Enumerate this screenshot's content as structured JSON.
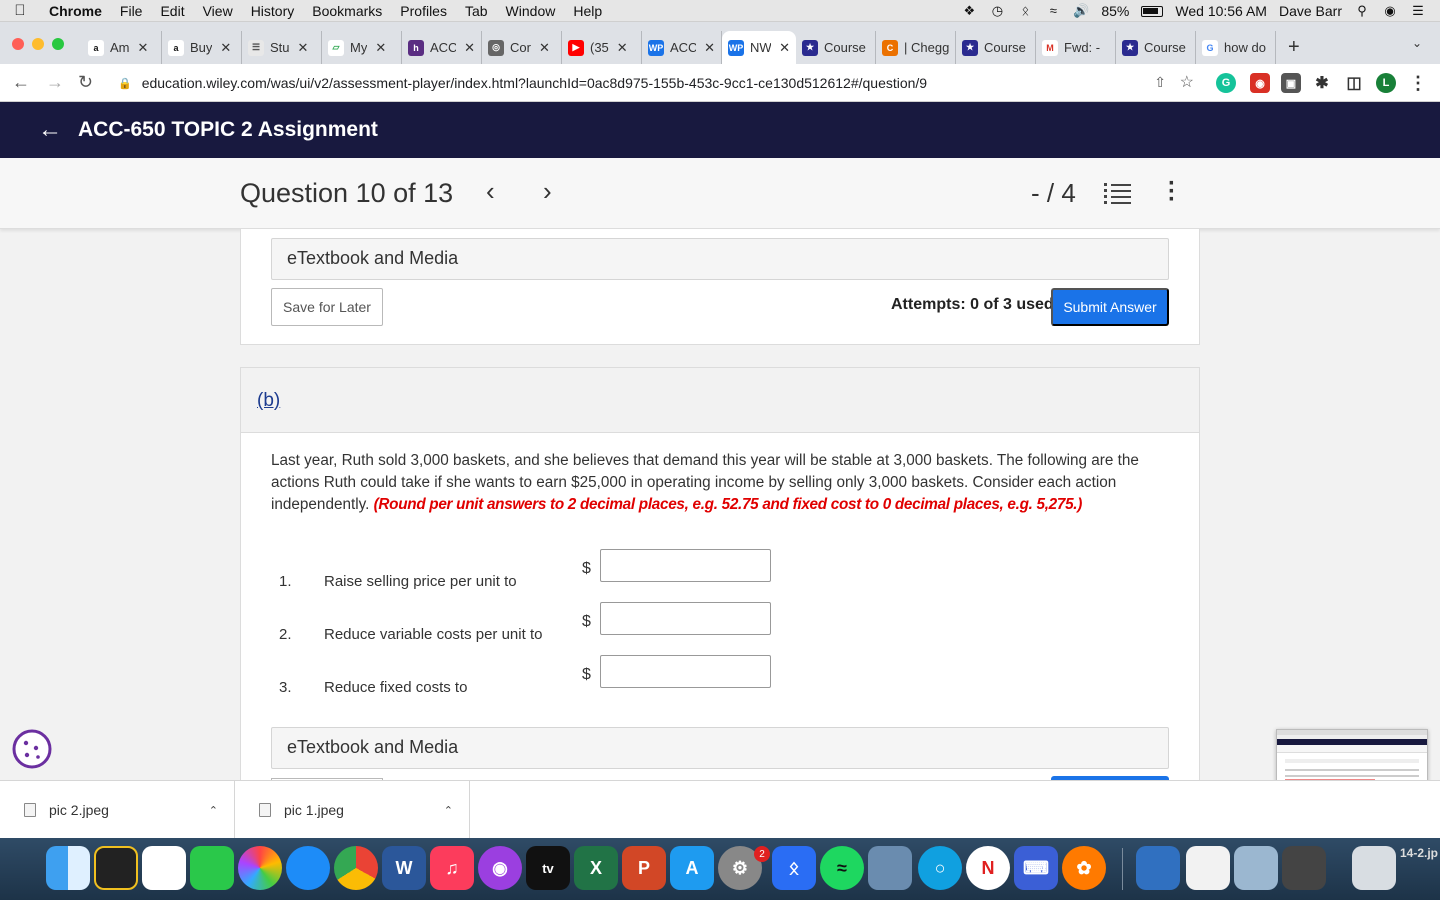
{
  "menubar": {
    "app": "Chrome",
    "items": [
      "File",
      "Edit",
      "View",
      "History",
      "Bookmarks",
      "Profiles",
      "Tab",
      "Window",
      "Help"
    ],
    "battery": "85%",
    "clock": "Wed 10:56 AM",
    "user": "Dave Barr"
  },
  "tabs": [
    {
      "label": "Am",
      "icon": "a",
      "color": "#ffffff",
      "fg": "#111"
    },
    {
      "label": "Buy",
      "icon": "a",
      "color": "#ffffff",
      "fg": "#111"
    },
    {
      "label": "Stu",
      "icon": "doc",
      "color": "#e8e8e8",
      "fg": "#555"
    },
    {
      "label": "My",
      "icon": "book",
      "color": "#ffffff",
      "fg": "#3a5"
    },
    {
      "label": "ACC",
      "icon": "h",
      "color": "#5a2d82",
      "fg": "#fff"
    },
    {
      "label": "Cor",
      "icon": "globe",
      "color": "#666",
      "fg": "#fff"
    },
    {
      "label": "(35",
      "icon": "yt",
      "color": "#ff0000",
      "fg": "#fff"
    },
    {
      "label": "ACC",
      "icon": "WP",
      "color": "#1a73e8",
      "fg": "#fff"
    },
    {
      "label": "NW",
      "icon": "WP",
      "color": "#1a73e8",
      "fg": "#fff",
      "active": true
    },
    {
      "label": "Course",
      "icon": "star",
      "color": "#2a2a8f",
      "fg": "#fff"
    },
    {
      "label": "| Chegg",
      "icon": "C",
      "color": "#eb7100",
      "fg": "#fff"
    },
    {
      "label": "Course",
      "icon": "star",
      "color": "#2a2a8f",
      "fg": "#fff"
    },
    {
      "label": "Fwd: -",
      "icon": "M",
      "color": "#ffffff",
      "fg": "#d93025"
    },
    {
      "label": "Course",
      "icon": "star",
      "color": "#2a2a8f",
      "fg": "#fff"
    },
    {
      "label": "how do",
      "icon": "G",
      "color": "#ffffff",
      "fg": "#4285f4"
    }
  ],
  "address": {
    "url": "education.wiley.com/was/ui/v2/assessment-player/index.html?launchId=0ac8d975-155b-453c-9cc1-ce130d512612#/question/9"
  },
  "header": {
    "title": "ACC-650 TOPIC 2 Assignment"
  },
  "qnav": {
    "title": "Question 10 of 13",
    "score": "- / 4"
  },
  "section1": {
    "etext": "eTextbook and Media",
    "save_label": "Save for Later",
    "attempts": "Attempts: 0 of 3 used",
    "submit_label": "Submit Answer"
  },
  "section2": {
    "part": "(b)",
    "text": "Last year, Ruth sold 3,000 baskets, and she believes that demand this year will be stable at 3,000 baskets. The following are the actions Ruth could take if she wants to earn $25,000 in operating income by selling only 3,000 baskets. Consider each action independently.",
    "instruction": "(Round per unit answers to 2 decimal places, e.g. 52.75 and fixed cost to 0 decimal places, e.g. 5,275.)",
    "items": [
      {
        "num": "1.",
        "label": "Raise selling price per unit to",
        "currency": "$",
        "value": ""
      },
      {
        "num": "2.",
        "label": "Reduce variable costs per unit to",
        "currency": "$",
        "value": ""
      },
      {
        "num": "3.",
        "label": "Reduce fixed costs to",
        "currency": "$",
        "value": ""
      }
    ],
    "etext": "eTextbook and Media"
  },
  "downloads": [
    {
      "name": "pic 2.jpeg"
    },
    {
      "name": "pic 1.jpeg"
    }
  ],
  "dock": {
    "badge": "2",
    "side_label": "14-2.jp"
  },
  "colors": {
    "header_bg": "#18193f",
    "submit_bg": "#1a73e8",
    "instruction_red": "#e00000",
    "part_link": "#1c3b8f"
  }
}
